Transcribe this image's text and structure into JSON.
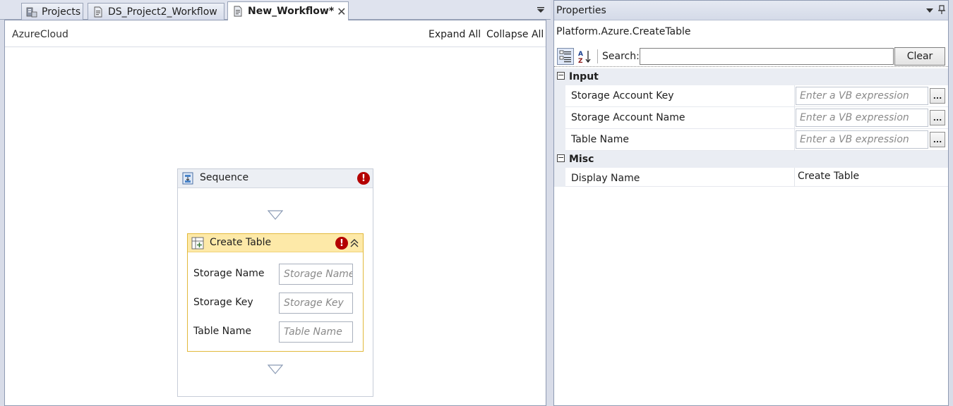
{
  "tabs": [
    {
      "label": "Projects",
      "icon": "projects-icon"
    },
    {
      "label": "DS_Project2_Workflow",
      "icon": "workflow-file-icon"
    },
    {
      "label": "New_Workflow*",
      "icon": "workflow-file-icon",
      "active": true
    }
  ],
  "designer": {
    "breadcrumb": "AzureCloud",
    "expand_all": "Expand All",
    "collapse_all": "Collapse All",
    "sequence": {
      "title": "Sequence",
      "activity": {
        "title": "Create Table",
        "fields": [
          {
            "label": "Storage Name",
            "placeholder": "Storage Name"
          },
          {
            "label": "Storage Key",
            "placeholder": "Storage Key"
          },
          {
            "label": "Table Name",
            "placeholder": "Table Name"
          }
        ]
      }
    }
  },
  "properties": {
    "title": "Properties",
    "type_name": "Platform.Azure.CreateTable",
    "search_label": "Search:",
    "search_value": "",
    "clear_label": "Clear",
    "categories": [
      {
        "name": "Input",
        "toggle": "−",
        "props": [
          {
            "name": "Storage Account Key",
            "placeholder": "Enter a VB expression",
            "button": "..."
          },
          {
            "name": "Storage Account Name",
            "placeholder": "Enter a VB expression",
            "button": "..."
          },
          {
            "name": "Table Name",
            "placeholder": "Enter a VB expression",
            "button": "..."
          }
        ]
      },
      {
        "name": "Misc",
        "toggle": "−",
        "props": [
          {
            "name": "Display Name",
            "value": "Create Table"
          }
        ]
      }
    ]
  },
  "colors": {
    "error": "#b40000",
    "activity_header": "#fde9a8",
    "activity_border": "#e2b93c"
  }
}
